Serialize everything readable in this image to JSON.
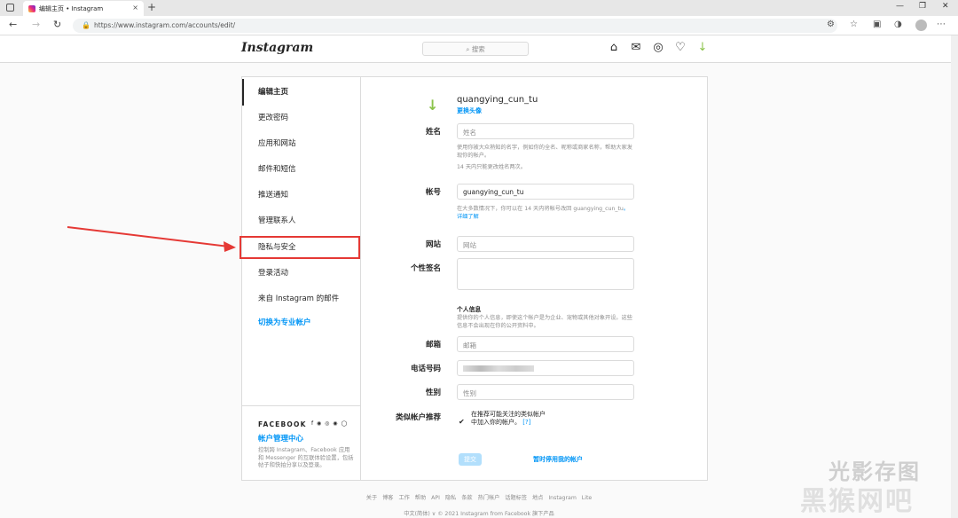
{
  "browser": {
    "tab_title": "编辑主页 • Instagram",
    "url": "https://www.instagram.com/accounts/edit/",
    "new_tab": "+",
    "close_tab": "×"
  },
  "header": {
    "logo": "Instagram",
    "search_placeholder": "搜索"
  },
  "sidebar": {
    "items": [
      {
        "label": "编辑主页"
      },
      {
        "label": "更改密码"
      },
      {
        "label": "应用和网站"
      },
      {
        "label": "邮件和短信"
      },
      {
        "label": "推送通知"
      },
      {
        "label": "管理联系人"
      },
      {
        "label": "隐私与安全"
      },
      {
        "label": "登录活动"
      },
      {
        "label": "来自 Instagram 的邮件"
      },
      {
        "label": "切换为专业帐户"
      }
    ],
    "facebook": {
      "title": "FACEBOOK",
      "icons": "f ◉ ◎ ◉ ◯",
      "center": "帐户管理中心",
      "desc": "控制跨 Instagram、Facebook 应用和 Messenger 的互联体验设置，包括帖子和快拍分享以及登录。"
    }
  },
  "form": {
    "username_display": "quangying_cun_tu",
    "change_photo": "更换头像",
    "name_label": "姓名",
    "name_placeholder": "姓名",
    "name_hint": "使用你被大众熟知的名字，例如你的全名、昵称或商家名称，帮助大家发现你的帐户。",
    "name_hint2": "14 天内只能更改姓名两次。",
    "username_label": "帐号",
    "username_value": "guangying_cun_tu",
    "username_hint": "在大多数情况下，你可以在 14 天内将帐号改回 guangying_cun_tu",
    "username_hint_link": "。详细了解",
    "website_label": "网站",
    "website_placeholder": "网站",
    "bio_label": "个性签名",
    "personal_info_title": "个人信息",
    "personal_info_hint": "提供你的个人信息，即使这个帐户是为企业、宠物或其他对象开设。这些信息不会出现在你的公开资料中。",
    "email_label": "邮箱",
    "email_placeholder": "邮箱",
    "phone_label": "电话号码",
    "gender_label": "性别",
    "gender_placeholder": "性别",
    "similar_label": "类似帐户推荐",
    "similar_text": "在推荐可能关注的类似帐户中加入你的帐户。",
    "similar_help": "[?]",
    "submit": "提交",
    "disable": "暂时停用我的帐户"
  },
  "footer": {
    "links": "关于 博客 工作 帮助 API 隐私 条款 热门帐户 话题标签 地点 Instagram Lite",
    "lang": "中文(简体) ∨",
    "copyright": "© 2021 Instagram from Facebook 旗下产品"
  },
  "watermark": {
    "line1": "光影存图",
    "line2": "黑猴网吧"
  }
}
